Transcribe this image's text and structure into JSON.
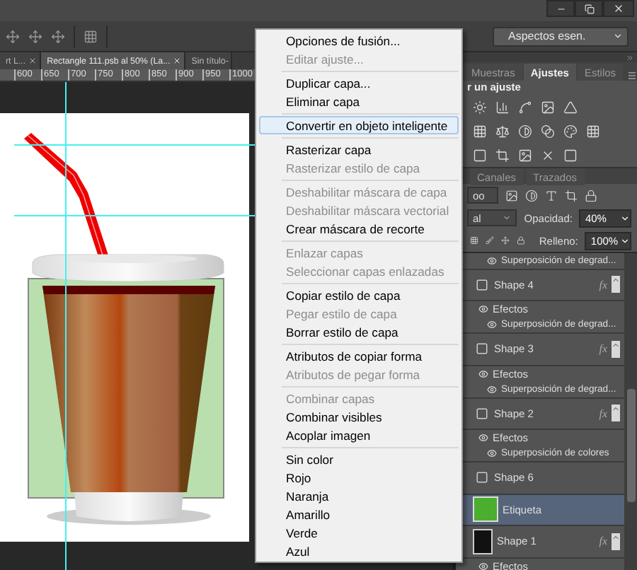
{
  "workspace": "Aspectos esen.",
  "doc_tabs": [
    {
      "label": "rt L...",
      "selected": false
    },
    {
      "label": "Rectangle 111.psb al 50% (La...",
      "selected": true
    },
    {
      "label": "Sin título-",
      "selected": false
    }
  ],
  "ruler": [
    "600",
    "650",
    "700",
    "750",
    "800",
    "850",
    "900",
    "950",
    "1000"
  ],
  "panel_tabs": [
    {
      "label": "Muestras",
      "selected": false
    },
    {
      "label": "Ajustes",
      "selected": true
    },
    {
      "label": "Estilos",
      "selected": false
    }
  ],
  "adjust_heading": "r un ajuste",
  "layers_tabs": [
    {
      "label": "Canales",
      "selected": false
    },
    {
      "label": "Trazados",
      "selected": false
    }
  ],
  "filter": "oo",
  "blend": "al",
  "opacity": {
    "label": "Opacidad:",
    "value": "40%"
  },
  "fill": {
    "label": "Relleno:",
    "value": "100%"
  },
  "layers": [
    {
      "kind": "effect",
      "name": "Superposición de degrad..."
    },
    {
      "kind": "layer",
      "name": "Shape 4",
      "thumb": {
        "kind": "vector"
      },
      "badge": "fx",
      "selected": false
    },
    {
      "kind": "effects",
      "name": "Efectos"
    },
    {
      "kind": "effect",
      "name": "Superposición de degrad..."
    },
    {
      "kind": "layer",
      "name": "Shape 3",
      "thumb": {
        "kind": "vector"
      },
      "badge": "fx",
      "selected": false
    },
    {
      "kind": "effects",
      "name": "Efectos"
    },
    {
      "kind": "effect",
      "name": "Superposición de degrad..."
    },
    {
      "kind": "layer",
      "name": "Shape 2",
      "thumb": {
        "kind": "vector"
      },
      "badge": "fx",
      "selected": false
    },
    {
      "kind": "effects",
      "name": "Efectos"
    },
    {
      "kind": "effect",
      "name": "Superposición de colores"
    },
    {
      "kind": "layer",
      "name": "Shape 6",
      "thumb": {
        "kind": "vector"
      },
      "selected": false
    },
    {
      "kind": "layer",
      "name": "Etiqueta",
      "thumb": {
        "kind": "swatch"
      },
      "selected": true
    },
    {
      "kind": "layer",
      "name": "Shape 1",
      "thumb": {
        "kind": "dark"
      },
      "badge": "fx",
      "selected": false
    },
    {
      "kind": "effects",
      "name": "Efectos"
    }
  ],
  "menu": [
    [
      {
        "label": "Opciones de fusión...",
        "disabled": false,
        "selected": false
      },
      {
        "label": "Editar ajuste...",
        "disabled": true,
        "selected": false
      }
    ],
    [
      {
        "label": "Duplicar capa...",
        "disabled": false,
        "selected": false
      },
      {
        "label": "Eliminar capa",
        "disabled": false,
        "selected": false
      }
    ],
    [
      {
        "label": "Convertir en objeto inteligente",
        "disabled": false,
        "selected": true
      }
    ],
    [
      {
        "label": "Rasterizar capa",
        "disabled": false,
        "selected": false
      },
      {
        "label": "Rasterizar estilo de capa",
        "disabled": true,
        "selected": false
      }
    ],
    [
      {
        "label": "Deshabilitar máscara de capa",
        "disabled": true,
        "selected": false
      },
      {
        "label": "Deshabilitar máscara vectorial",
        "disabled": true,
        "selected": false
      },
      {
        "label": "Crear máscara de recorte",
        "disabled": false,
        "selected": false
      }
    ],
    [
      {
        "label": "Enlazar capas",
        "disabled": true,
        "selected": false
      },
      {
        "label": "Seleccionar capas enlazadas",
        "disabled": true,
        "selected": false
      }
    ],
    [
      {
        "label": "Copiar estilo de capa",
        "disabled": false,
        "selected": false
      },
      {
        "label": "Pegar estilo de capa",
        "disabled": true,
        "selected": false
      },
      {
        "label": "Borrar estilo de capa",
        "disabled": false,
        "selected": false
      }
    ],
    [
      {
        "label": "Atributos de copiar forma",
        "disabled": false,
        "selected": false
      },
      {
        "label": "Atributos de pegar forma",
        "disabled": true,
        "selected": false
      }
    ],
    [
      {
        "label": "Combinar capas",
        "disabled": true,
        "selected": false
      },
      {
        "label": "Combinar visibles",
        "disabled": false,
        "selected": false
      },
      {
        "label": "Acoplar imagen",
        "disabled": false,
        "selected": false
      }
    ],
    [
      {
        "label": "Sin color",
        "disabled": false,
        "selected": false
      },
      {
        "label": "Rojo",
        "disabled": false,
        "selected": false
      },
      {
        "label": "Naranja",
        "disabled": false,
        "selected": false
      },
      {
        "label": "Amarillo",
        "disabled": false,
        "selected": false
      },
      {
        "label": "Verde",
        "disabled": false,
        "selected": false
      },
      {
        "label": "Azul",
        "disabled": false,
        "selected": false
      }
    ]
  ]
}
